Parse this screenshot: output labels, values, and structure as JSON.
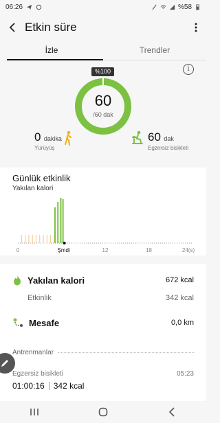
{
  "status_bar": {
    "time": "06:26",
    "battery": "%58"
  },
  "app_bar": {
    "title": "Etkin süre"
  },
  "tabs": [
    {
      "label": "İzle"
    },
    {
      "label": "Trendler"
    }
  ],
  "summary": {
    "percent_badge": "%100",
    "ring_value": "60",
    "ring_goal": "/60 dak",
    "progress": 1.0,
    "walking": {
      "value": "0",
      "unit": "dakika",
      "caption": "Yürüyüş"
    },
    "cycling": {
      "value": "60",
      "unit": "dak",
      "caption": "Egzersiz bisikleti"
    }
  },
  "daily": {
    "title": "Günlük etkinlik",
    "subtitle": "Yakılan kalori"
  },
  "chart_data": {
    "type": "bar",
    "title": "",
    "ylabel": "Yakılan kalori",
    "xlim": [
      0,
      24
    ],
    "x_ticks": [
      "0",
      "Şmdi",
      "12",
      "18",
      "24(s)"
    ],
    "bars_low": [
      0.5,
      1.0,
      1.5,
      2.0,
      2.5,
      3.0,
      3.5,
      4.0,
      4.5,
      5.0
    ],
    "bars_high": [
      5.1,
      5.5,
      5.9,
      6.2
    ]
  },
  "calories": {
    "label": "Yakılan kalori",
    "value": "672 kcal",
    "activity_label": "Etkinlik",
    "activity_value": "342 kcal"
  },
  "distance": {
    "label": "Mesafe",
    "value": "0,0 km"
  },
  "workouts": {
    "heading": "Antrenmanlar",
    "name": "Egzersiz bisikleti",
    "time": "05:23",
    "duration": "01:00:16",
    "kcal": "342 kcal"
  },
  "colors": {
    "green": "#7cc142",
    "accent_orange": "#f0a030",
    "walk_yellow": "#f2b31f"
  }
}
